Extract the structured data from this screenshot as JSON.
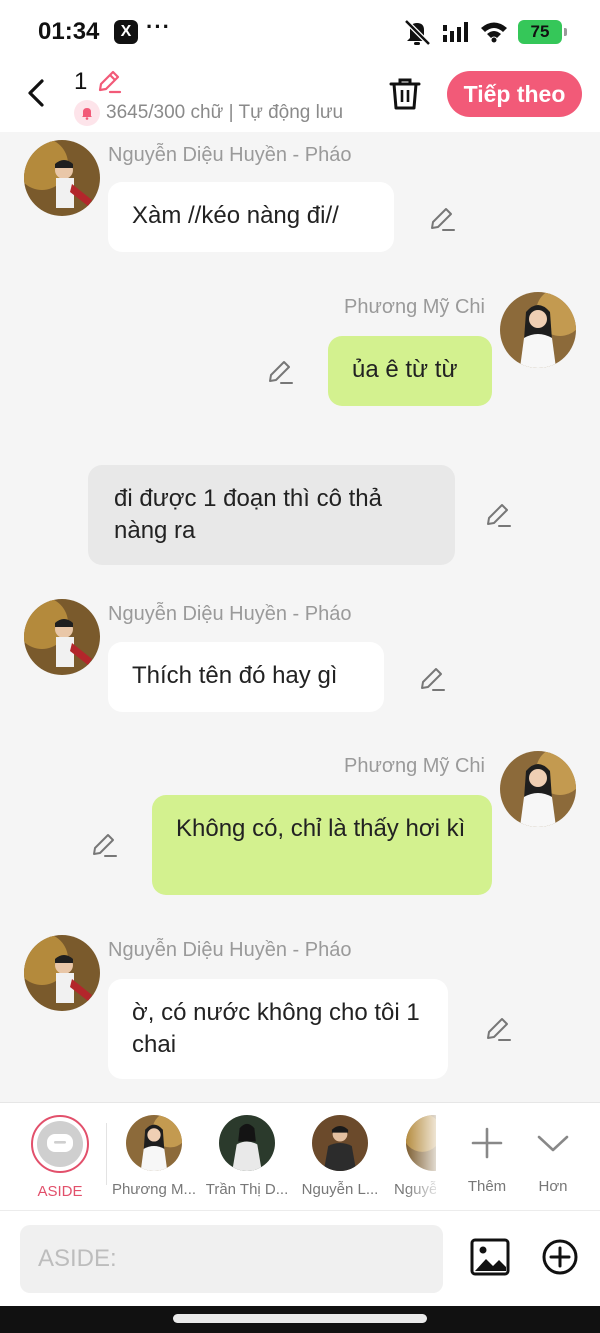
{
  "status_bar": {
    "time": "01:34",
    "notif_app": "X",
    "more_dots": "···",
    "battery": "75"
  },
  "header": {
    "title": "1",
    "word_count": "3645/300 chữ | Tự động lưu",
    "next_label": "Tiếp theo"
  },
  "messages": [
    {
      "type": "left",
      "name": "Nguyễn Diệu Huyền - Pháo",
      "text": "Xàm //kéo nàng đi//"
    },
    {
      "type": "right",
      "name": "Phương Mỹ Chi",
      "text": "ủa ê từ từ"
    },
    {
      "type": "aside",
      "text": "đi được 1 đoạn thì cô thả nàng ra"
    },
    {
      "type": "left",
      "name": "Nguyễn Diệu Huyền - Pháo",
      "text": "Thích tên đó hay gì"
    },
    {
      "type": "right",
      "name": "Phương Mỹ Chi",
      "text": "Không có, chỉ là thấy hơi kì"
    },
    {
      "type": "left",
      "name": "Nguyễn Diệu Huyền - Pháo",
      "text": "ờ, có nước không cho tôi 1 chai"
    }
  ],
  "characters": [
    {
      "label": "ASIDE",
      "selected": true
    },
    {
      "label": "Phương M..."
    },
    {
      "label": "Trần Thị D..."
    },
    {
      "label": "Nguyễn L..."
    },
    {
      "label": "Nguyễ"
    }
  ],
  "actions": {
    "add_label": "Thêm",
    "more_label": "Hơn"
  },
  "composer": {
    "placeholder": "ASIDE:"
  },
  "colors": {
    "accent": "#f25a78",
    "green_bubble": "#d3f18f",
    "aside_bubble": "#e8e8e8"
  }
}
